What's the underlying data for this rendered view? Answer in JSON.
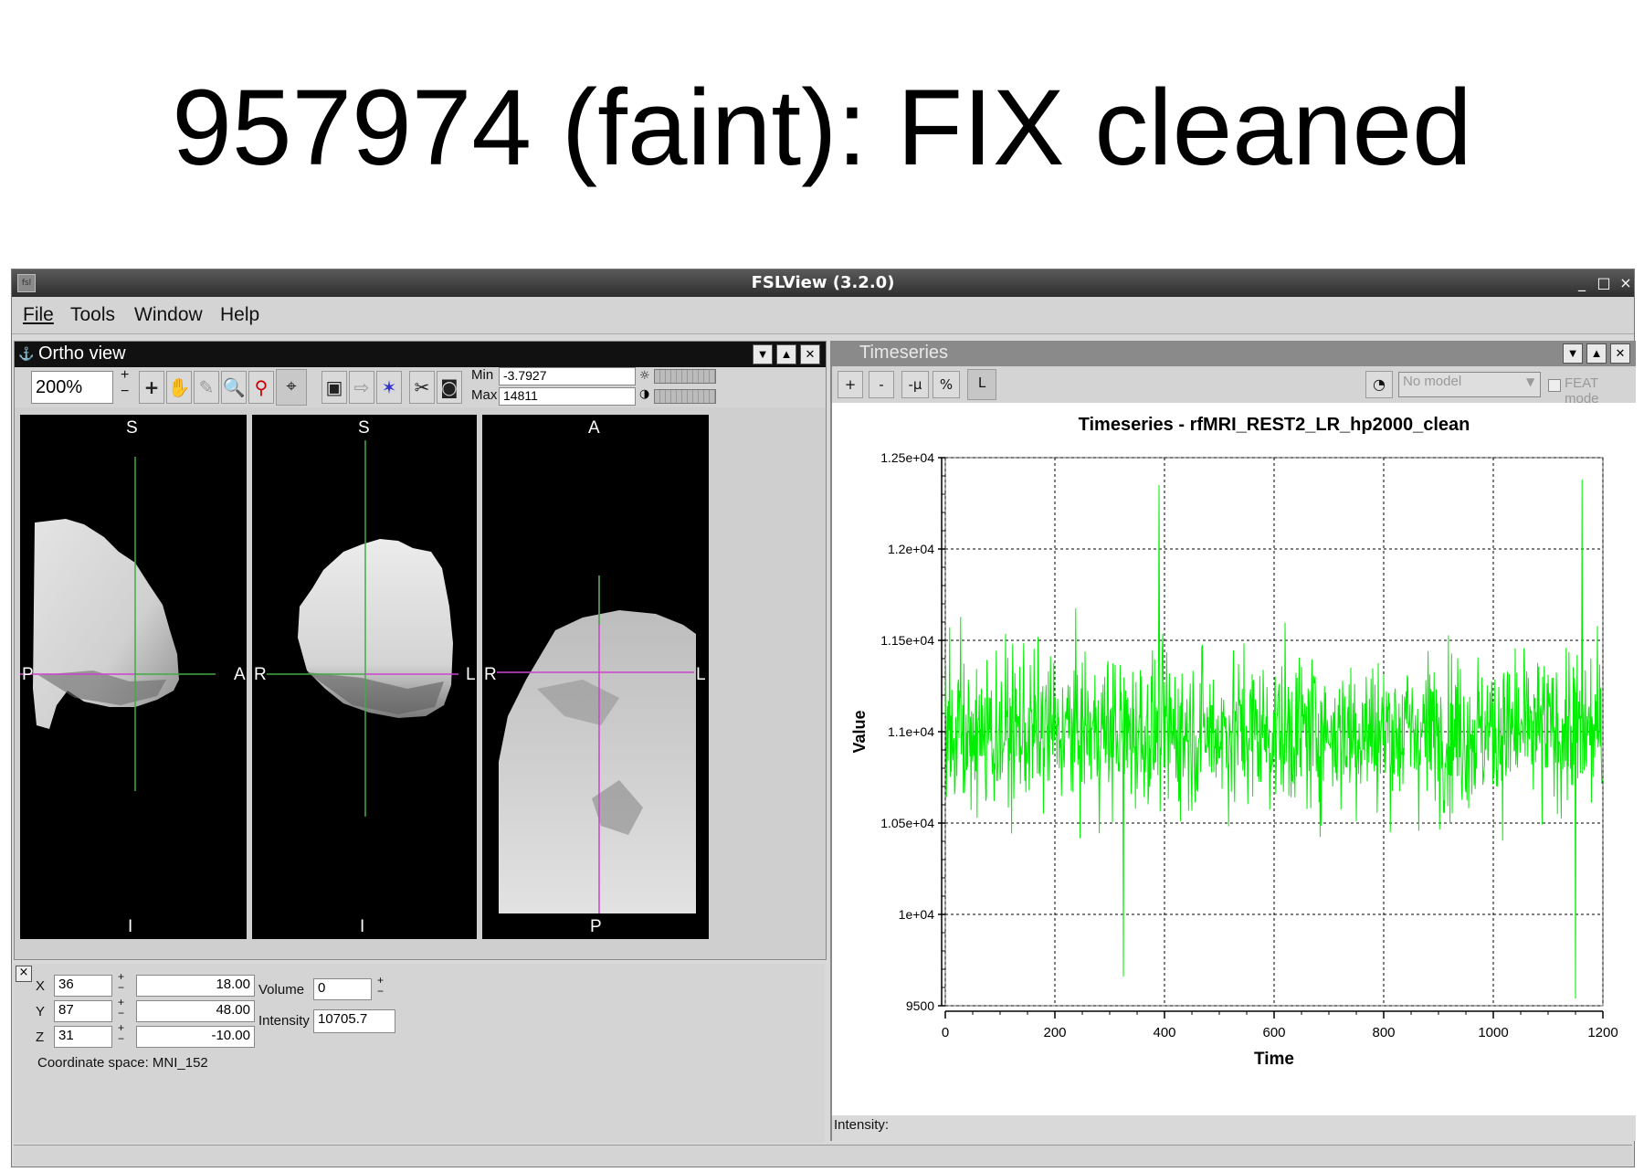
{
  "slide": {
    "title": "957974 (faint): FIX cleaned"
  },
  "window": {
    "title": "FSLView (3.2.0)",
    "icon_text": "fsl",
    "min_glyph": "_",
    "max_glyph": "□",
    "close_glyph": "×"
  },
  "menu": [
    {
      "label": "File"
    },
    {
      "label": "Tools"
    },
    {
      "label": "Window"
    },
    {
      "label": "Help"
    }
  ],
  "ortho": {
    "title": "Ortho view",
    "zoom": "200%",
    "plus": "+",
    "minus": "−",
    "min_label": "Min",
    "min_value": "-3.7927",
    "max_label": "Max",
    "max_value": "14811",
    "views": [
      {
        "top": "S",
        "bottom": "I",
        "left": "P",
        "right": "A"
      },
      {
        "top": "S",
        "bottom": "I",
        "left": "R",
        "right": "L"
      },
      {
        "top": "A",
        "bottom": "P",
        "left": "R",
        "right": "L"
      }
    ]
  },
  "coords": {
    "close_glyph": "×",
    "x_label": "X",
    "x_voxel": "36",
    "x_mm": "18.00",
    "y_label": "Y",
    "y_voxel": "87",
    "y_mm": "48.00",
    "z_label": "Z",
    "z_voxel": "31",
    "z_mm": "-10.00",
    "volume_label": "Volume",
    "volume_value": "0",
    "intensity_label": "Intensity",
    "intensity_value": "10705.7",
    "space": "Coordinate space: MNI_152"
  },
  "timeseries": {
    "panel_title": "Timeseries",
    "buttons": [
      "+",
      "-",
      "-μ",
      "%",
      "L"
    ],
    "model_placeholder": "No model",
    "feat_label": "FEAT mode",
    "footer": "Intensity:"
  },
  "chart_data": {
    "type": "line",
    "title": "Timeseries - rfMRI_REST2_LR_hp2000_clean",
    "xlabel": "Time",
    "ylabel": "Value",
    "xlim": [
      0,
      1200
    ],
    "ylim": [
      9500,
      12500
    ],
    "xticks": [
      0,
      200,
      400,
      600,
      800,
      1000,
      1200
    ],
    "yticks": [
      9500,
      10000,
      10500,
      11000,
      11500,
      12000,
      12500
    ],
    "ytick_labels": [
      "9500",
      "1e+04",
      "1.05e+04",
      "1.1e+04",
      "1.15e+04",
      "1.2e+04",
      "1.25e+04"
    ],
    "grid": true,
    "series": [
      {
        "color": "#00ee00",
        "n_points": 1200,
        "mean": 11000,
        "std": 330,
        "min": 9540,
        "max": 12380,
        "peaks": [
          {
            "x": 390,
            "y": 12350
          },
          {
            "x": 1162,
            "y": 12380
          },
          {
            "x": 1150,
            "y": 9540
          },
          {
            "x": 325,
            "y": 9660
          }
        ]
      }
    ]
  },
  "colors": {
    "plot_line": "#00ee00",
    "crosshair_h": "#cc44cc",
    "crosshair_v": "#44aa44",
    "header_active": "#111111",
    "header_inactive": "#8a8a8a"
  }
}
